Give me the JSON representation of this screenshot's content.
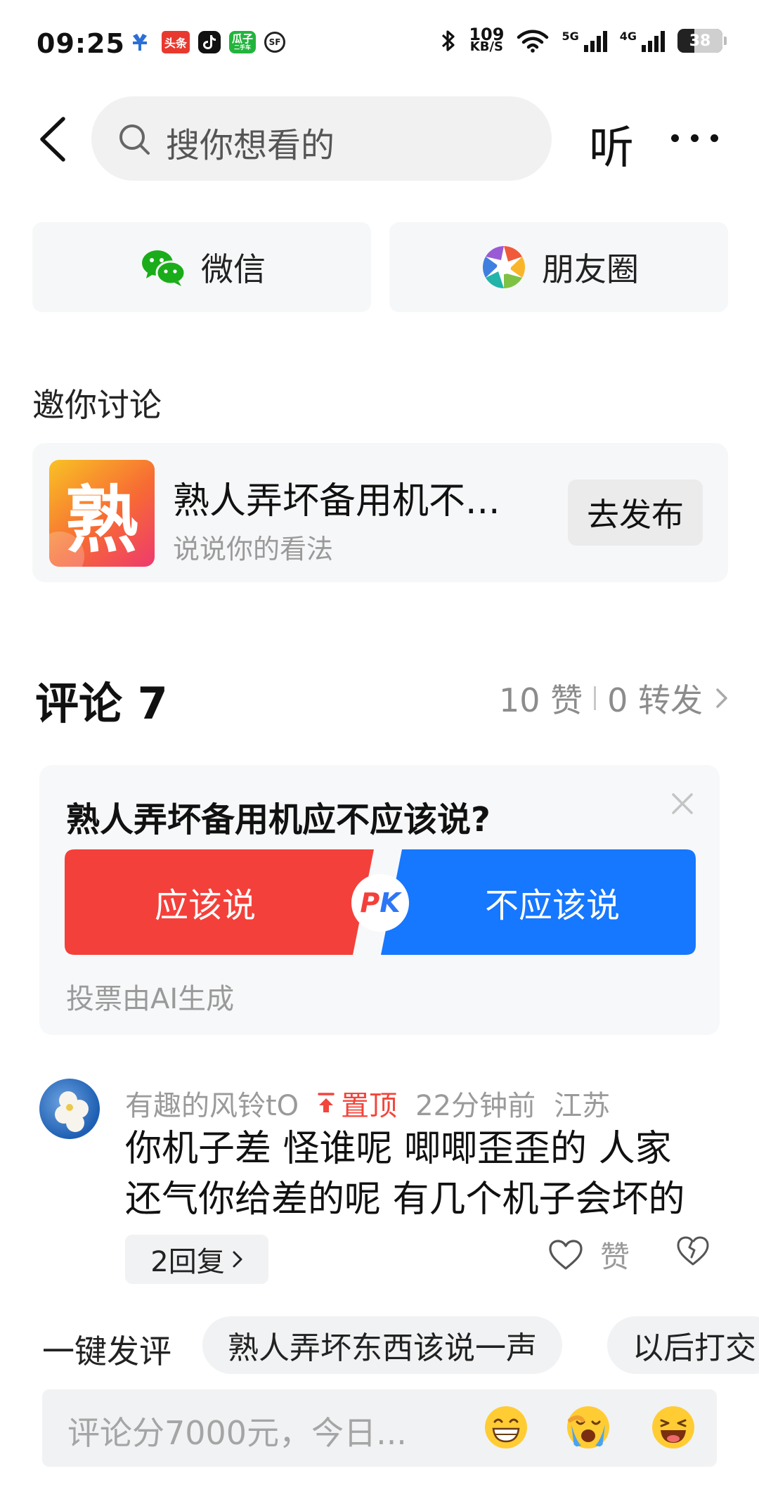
{
  "status_bar": {
    "time": "09:25",
    "notif_apps": [
      "bank-icon",
      "toutiao-icon",
      "tiktok-icon",
      "guazi-icon",
      "sf-icon"
    ],
    "toutiao_label": "头条",
    "guazi_label_1": "瓜子",
    "guazi_label_2": "二手车",
    "sf_label": "SF",
    "net_speed_value": "109",
    "net_speed_unit": "KB/S",
    "net_1": "5G",
    "net_2": "4G",
    "battery": "38"
  },
  "header": {
    "search_placeholder": "搜你想看的",
    "listen_label": "听"
  },
  "share": {
    "wechat_label": "微信",
    "moments_label": "朋友圈"
  },
  "invite": {
    "title": "邀你讨论",
    "topic_thumb_char": "熟",
    "topic_title": "熟人弄坏备用机不...",
    "topic_sub": "说说你的看法",
    "publish_label": "去发布"
  },
  "comments_header": {
    "title": "评论 7",
    "likes": "10 赞",
    "reposts": "0 转发"
  },
  "poll": {
    "question": "熟人弄坏备用机应不应该说?",
    "option_yes": "应该说",
    "option_no": "不应该说",
    "pk_p": "P",
    "pk_k": "K",
    "footer": "投票由AI生成",
    "colors": {
      "yes": "#f4403a",
      "no": "#1677ff"
    }
  },
  "comment": {
    "username": "有趣的风铃tO",
    "pinned_label": "置顶",
    "time": "22分钟前",
    "location": "江苏",
    "text_line_1": "你机子差 怪谁呢 唧唧歪歪的 人家",
    "text_line_2": "还气你给差的呢 有几个机子会坏的",
    "replies_label": "2回复",
    "like_label": "赞"
  },
  "quick_comment": {
    "label": "一键发评",
    "chips": [
      "熟人弄坏东西该说一声",
      "以后打交"
    ]
  },
  "input_bar": {
    "placeholder": "评论分7000元，今日...",
    "emojis": [
      "grin-emoji",
      "cry-emoji",
      "laugh-emoji"
    ]
  }
}
